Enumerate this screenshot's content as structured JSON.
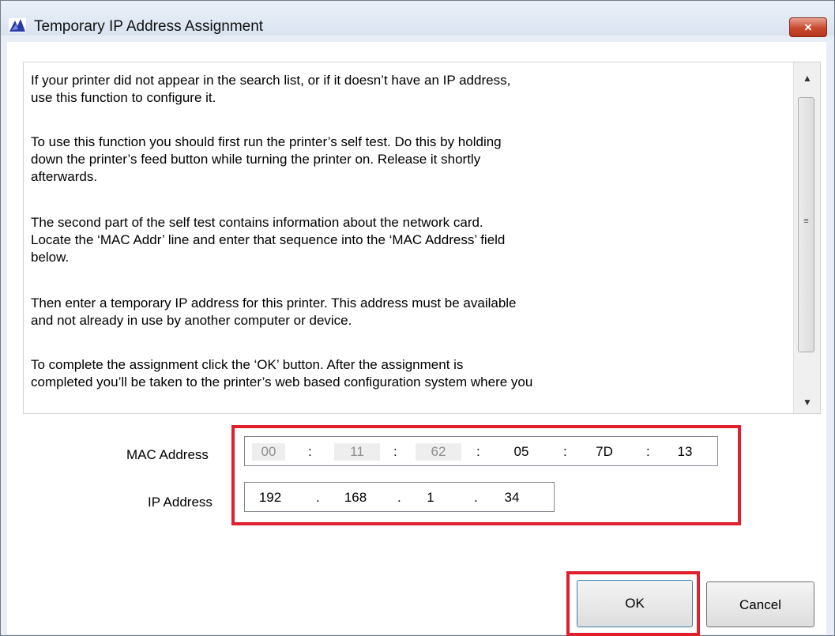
{
  "window": {
    "title": "Temporary IP Address Assignment",
    "close_label": "×"
  },
  "instructions": {
    "paragraphs": [
      [
        "If your printer did not appear in the search list, or if it doesn’t have an IP address,",
        "use this function to configure it."
      ],
      [
        "To use this function you should first run the printer’s self test.  Do this by holding",
        "down the printer’s feed button while turning the printer on.  Release it shortly",
        "afterwards."
      ],
      [
        "The second part of the self test contains information about the network card.",
        "Locate the ‘MAC Addr’ line and enter that sequence into the ‘MAC Address’ field",
        "below."
      ],
      [
        "Then enter a temporary IP address for this printer.  This address must be available",
        "and not already in use by another computer or device."
      ],
      [
        "To complete the assignment click the ‘OK’ button.  After the assignment is",
        "completed you’ll be taken to the printer’s web based configuration system where you"
      ]
    ]
  },
  "scrollbar": {
    "up_arrow": "▲",
    "grip": "≡",
    "down_arrow": "▼"
  },
  "form": {
    "mac_label": "MAC Address",
    "ip_label": "IP Address",
    "mac_segments": [
      "00",
      "11",
      "62",
      "05",
      "7D",
      "13"
    ],
    "mac_separator": ":",
    "ip_segments": [
      "192",
      "168",
      "1",
      "34"
    ],
    "ip_separator": "."
  },
  "buttons": {
    "ok": "OK",
    "cancel": "Cancel"
  },
  "colors": {
    "highlight": "#e0202e",
    "close_button": "#c9492e"
  }
}
